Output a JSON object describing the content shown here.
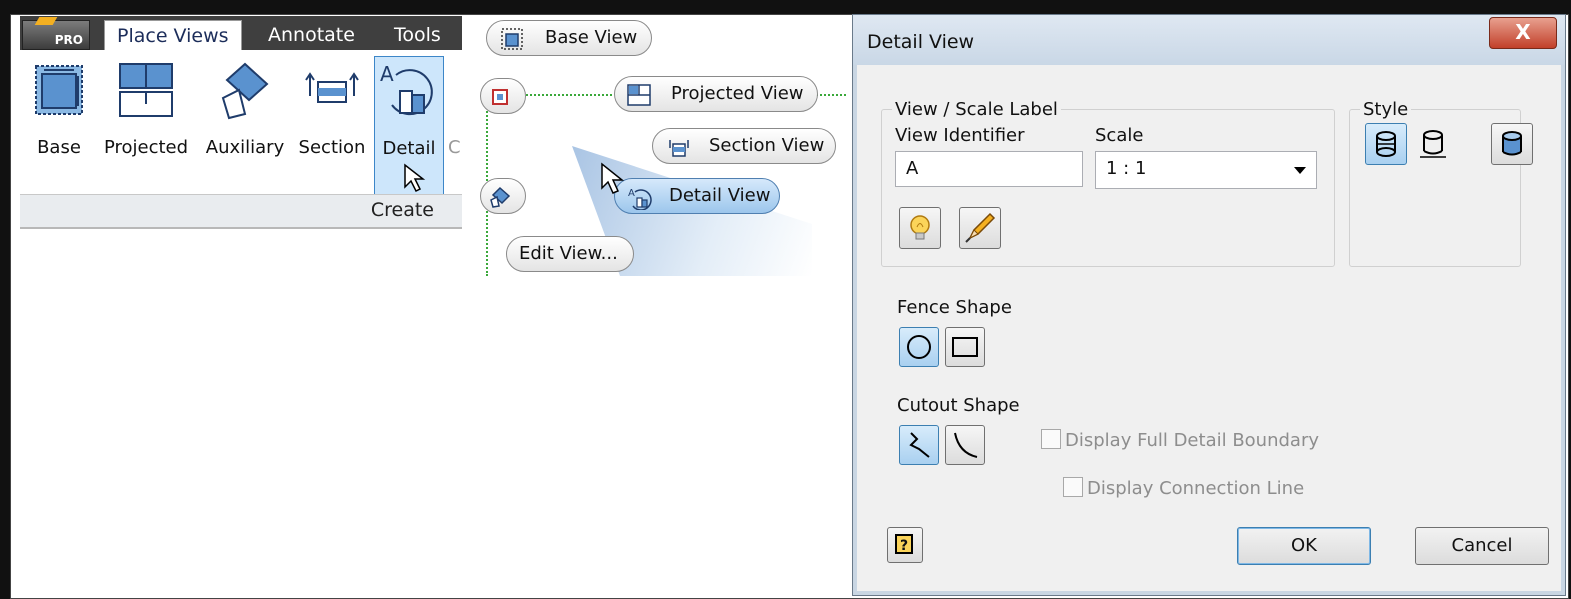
{
  "ribbon": {
    "pro_badge": "PRO",
    "tabs": [
      "Place Views",
      "Annotate",
      "Tools"
    ],
    "buttons": [
      "Base",
      "Projected",
      "Auxiliary",
      "Section",
      "Detail",
      "C"
    ],
    "group_label": "Create"
  },
  "marking_menu": {
    "base_view": "Base View",
    "projected_view": "Projected View",
    "section_view": "Section View",
    "detail_view": "Detail View",
    "edit_view": "Edit View..."
  },
  "dialog": {
    "title": "Detail View",
    "close_glyph": "X",
    "view_scale_label": {
      "legend": "View / Scale Label",
      "view_identifier_label": "View Identifier",
      "view_identifier_value": "A",
      "scale_label": "Scale",
      "scale_value": "1 : 1"
    },
    "style": {
      "legend": "Style"
    },
    "fence_shape_label": "Fence Shape",
    "cutout_shape_label": "Cutout Shape",
    "display_full_detail_boundary": "Display Full Detail Boundary",
    "display_connection_line": "Display Connection Line",
    "help_glyph": "?",
    "ok": "OK",
    "cancel": "Cancel"
  },
  "colors": {
    "ribbon_tabbar": "#3f3f3f",
    "selected_blue": "#cde6fb",
    "dialog_bg": "#f0f0f0",
    "close_red": "#c2402a"
  }
}
